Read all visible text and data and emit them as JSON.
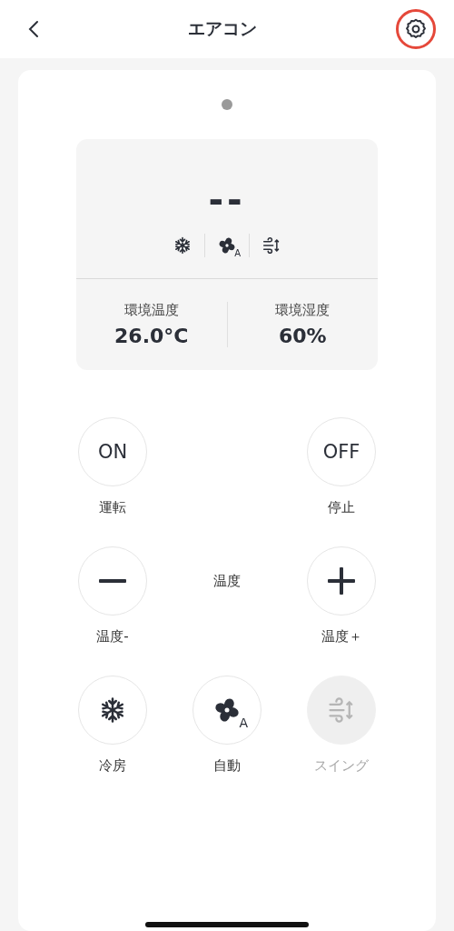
{
  "header": {
    "title": "エアコン",
    "settings": {
      "highlighted": true
    }
  },
  "status": {
    "temperature_display": "--",
    "modes": [
      {
        "kind": "cool"
      },
      {
        "kind": "fan",
        "letter": "A"
      },
      {
        "kind": "swing"
      }
    ],
    "readings": [
      {
        "label": "環境温度",
        "value": "26.0°C"
      },
      {
        "label": "環境湿度",
        "value": "60%"
      }
    ]
  },
  "controls": [
    [
      {
        "kind": "text",
        "text": "ON",
        "label": "運転",
        "disabled": false
      },
      {
        "kind": "empty"
      },
      {
        "kind": "text",
        "text": "OFF",
        "label": "停止",
        "disabled": false
      }
    ],
    [
      {
        "kind": "minus",
        "label": "温度-",
        "disabled": false
      },
      {
        "kind": "caption",
        "text": "温度"
      },
      {
        "kind": "plus",
        "label": "温度＋",
        "disabled": false
      }
    ],
    [
      {
        "kind": "cool",
        "label": "冷房",
        "disabled": false
      },
      {
        "kind": "fan",
        "letter": "A",
        "label": "自動",
        "disabled": false
      },
      {
        "kind": "swing",
        "label": "スイング",
        "disabled": true
      }
    ]
  ]
}
